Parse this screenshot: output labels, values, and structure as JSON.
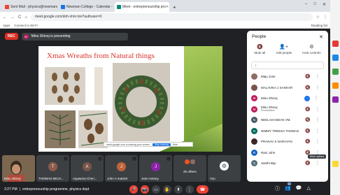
{
  "browser": {
    "tabs": [
      {
        "label": "Sent Mail - physics@newmancolle",
        "fav": "#ea4335",
        "active": false
      },
      {
        "label": "Newman College - Calendar - Sat",
        "fav": "#1a73e8",
        "active": false
      },
      {
        "label": "Meet - entrepreneurship pro",
        "fav": "#00897b",
        "active": true
      }
    ],
    "new_tab": "+",
    "window_controls": [
      "–",
      "□",
      "✕"
    ],
    "nav": [
      "←",
      "→",
      "C",
      "⌂"
    ],
    "url": "meet.google.com/dxh-vhnr-tze?authuser=0",
    "bookmarks": [
      "Apps",
      "Connect to Wi-Fi"
    ],
    "reading_list": "Reading list",
    "toolbar_icons": [
      "☆",
      "⋮"
    ]
  },
  "meet": {
    "rec": "REC",
    "presenter_initial": "M",
    "presenting_text": "Minu Shinoj is presenting",
    "slide_title": "Xmas Wreaths from Natural things",
    "search_strip": {
      "text": "meet.google.com is sharing your screen.",
      "stop": "Stop sharing",
      "hide": "Hide"
    },
    "tiles": [
      {
        "name": "Minu Shinoj",
        "initial": "",
        "color": "#6d5a45",
        "video": true
      },
      {
        "name": "THOMAS MICH...",
        "initial": "T",
        "color": "#8d5b4c"
      },
      {
        "name": "Aquwena Cheri...",
        "initial": "A",
        "color": "#795548"
      },
      {
        "name": "John A manisit",
        "initial": "J",
        "color": "#c0633a"
      },
      {
        "name": "Jeen Antony",
        "initial": "J",
        "color": "#8e24aa"
      },
      {
        "name": "25 others",
        "initial": "",
        "color": "#3c4043",
        "others": true
      },
      {
        "name": "You",
        "initial": "",
        "color": "#3c4043"
      }
    ],
    "time": "3:27 PM",
    "meeting_name": "entrepreneurship programme, physics dept",
    "controls": [
      "🎤",
      "📷",
      "▭",
      "✋",
      "⬆",
      "⋮"
    ],
    "end_call": "☎",
    "right_controls": [
      "ⓘ",
      "👥",
      "💬",
      "△"
    ],
    "people_count": "31"
  },
  "people_panel": {
    "title": "People",
    "close": "✕",
    "actions": [
      {
        "icon": "🔇",
        "label": "Mute all"
      },
      {
        "icon": "👤+",
        "label": "Add people"
      },
      {
        "icon": "⚙",
        "label": "Host controls"
      }
    ],
    "search_placeholder": "",
    "participants": [
      {
        "name": "Maju Jose",
        "sub": "",
        "initial": "",
        "color": "#8d6e63",
        "speaking": false
      },
      {
        "name": "MALAVIKA J SANKAR",
        "sub": "",
        "initial": "",
        "color": "#795548",
        "speaking": false
      },
      {
        "name": "Minu Shinoj",
        "sub": "",
        "initial": "M",
        "color": "#c2185b",
        "speaking": true
      },
      {
        "name": "Minu Shinoj",
        "sub": "Presentation",
        "initial": "M",
        "color": "#c2185b",
        "speaking": false
      },
      {
        "name": "NEELAKANDAN VM.",
        "sub": "",
        "initial": "N",
        "color": "#455a64",
        "speaking": false
      },
      {
        "name": "NIMMY TREESA THOMAS",
        "sub": "",
        "initial": "N",
        "color": "#00695c",
        "speaking": false
      },
      {
        "name": "PRANAV S NARAYAN",
        "sub": "",
        "initial": "",
        "color": "#3e2723",
        "speaking": false
      },
      {
        "name": "Rani John",
        "sub": "",
        "initial": "R",
        "color": "#1565c0",
        "speaking": false
      },
      {
        "name": "Santhi Biju",
        "sub": "",
        "initial": "S",
        "color": "#546e7a",
        "speaking": false
      }
    ],
    "tooltip": "More options"
  }
}
